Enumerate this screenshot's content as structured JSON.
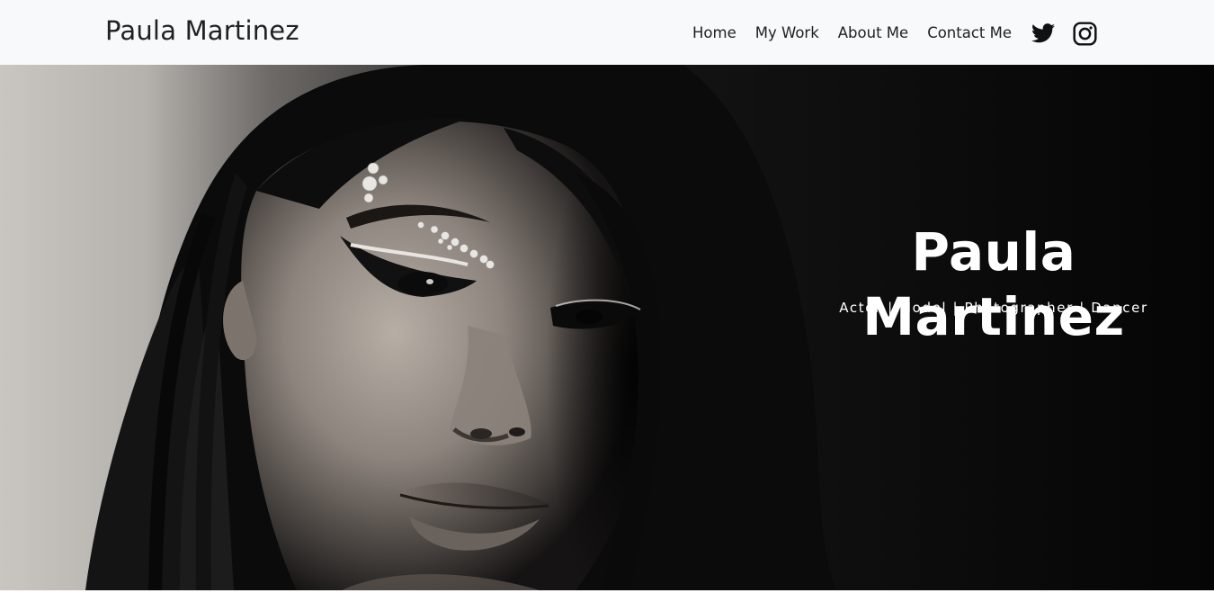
{
  "navbar": {
    "brand": "Paula Martinez",
    "links": [
      {
        "label": "Home"
      },
      {
        "label": "My Work"
      },
      {
        "label": "About Me"
      },
      {
        "label": "Contact Me"
      }
    ],
    "social_icons": [
      "twitter-icon",
      "instagram-icon"
    ]
  },
  "hero": {
    "title": "Paula Martinez",
    "subtitle": "Actor | Model | Photographer | Dancer",
    "photo": "portrait-photo"
  },
  "colors": {
    "navbar_bg": "#f8f9fa",
    "nav_text": "#212121",
    "hero_text": "#ffffff",
    "hero_bg": "#050505"
  }
}
